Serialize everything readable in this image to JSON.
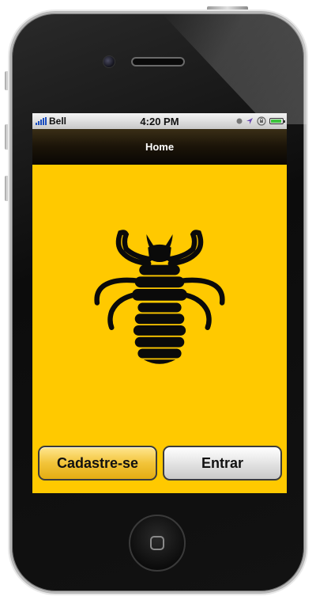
{
  "status_bar": {
    "carrier": "Bell",
    "time": "4:20 PM",
    "battery_level": 0.9
  },
  "nav": {
    "title": "Home"
  },
  "main": {
    "illustration_icon": "louse-icon",
    "buttons": {
      "register_label": "Cadastre-se",
      "enter_label": "Entrar"
    }
  },
  "colors": {
    "screen_background": "#ffc900",
    "nav_background": "#1b1408",
    "register_button": "#f2c43a",
    "enter_button": "#e4e4e4"
  }
}
